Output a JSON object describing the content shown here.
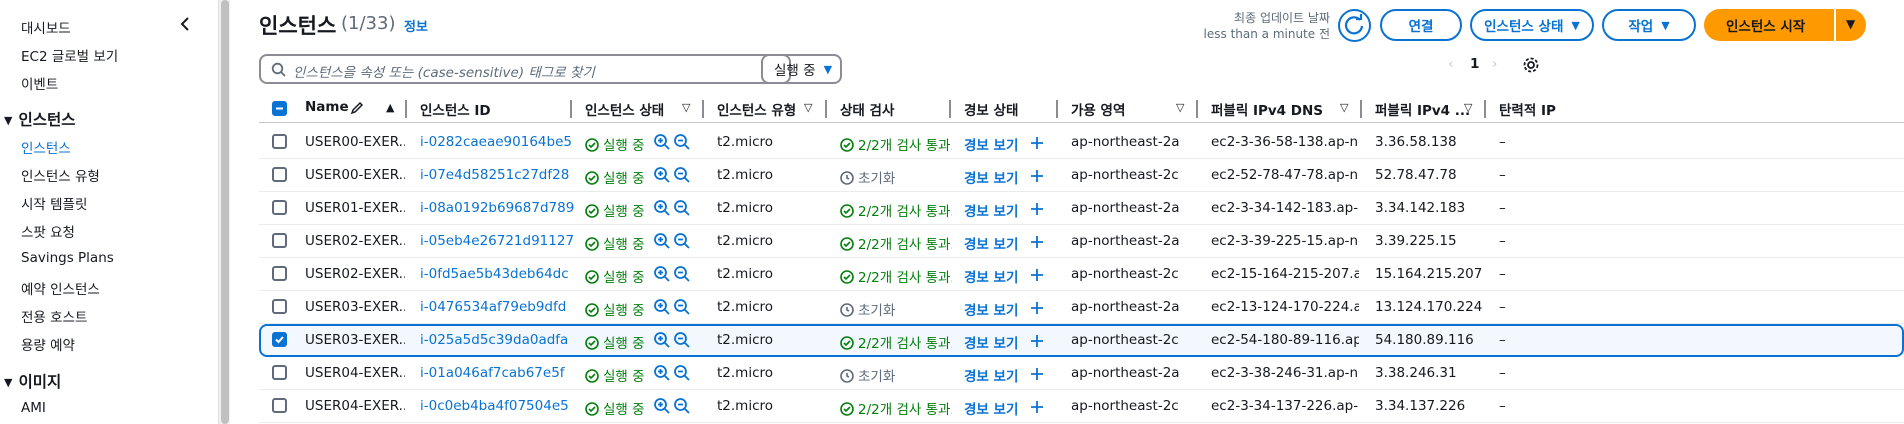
{
  "sidebar": {
    "top_items": [
      "대시보드",
      "EC2 글로벌 보기",
      "이벤트"
    ],
    "sections": [
      {
        "title": "인스턴스",
        "items": [
          "인스턴스",
          "인스턴스 유형",
          "시작 템플릿",
          "스팟 요청",
          "Savings Plans",
          "예약 인스턴스",
          "전용 호스트",
          "용량 예약"
        ]
      },
      {
        "title": "이미지",
        "items": [
          "AMI"
        ]
      }
    ]
  },
  "header": {
    "title": "인스턴스",
    "count": "(1/33)",
    "info": "정보",
    "last_update_label": "최종 업데이트 날짜",
    "last_update_value": "less than a minute 전",
    "connect": "연결",
    "instance_state": "인스턴스 상태",
    "actions": "작업",
    "launch": "인스턴스 시작"
  },
  "search": {
    "placeholder": "인스턴스을 속성 또는 (case-sensitive) 태그로 찾기"
  },
  "state_filter": "실행 중",
  "pager": {
    "page": "1"
  },
  "columns": [
    "Name",
    "인스턴스 ID",
    "인스턴스 상태",
    "인스턴스 유형",
    "상태 검사",
    "경보 상태",
    "가용 영역",
    "퍼블릭 IPv4 DNS",
    "퍼블릭 IPv4 ...",
    "탄력적 IP"
  ],
  "rows": [
    {
      "name": "USER00-EXER...",
      "id": "i-0282caeae90164be5",
      "state": "실행 중",
      "type": "t2.micro",
      "check": "2/2개 검사 통과...",
      "check_ok": true,
      "alarm": "경보 보기",
      "az": "ap-northeast-2a",
      "dns": "ec2-3-36-58-138.ap-no...",
      "ip": "3.36.58.138",
      "eip": "–",
      "checked": false
    },
    {
      "name": "USER00-EXER...",
      "id": "i-07e4d58251c27df28",
      "state": "실행 중",
      "type": "t2.micro",
      "check": "초기화",
      "check_ok": false,
      "alarm": "경보 보기",
      "az": "ap-northeast-2c",
      "dns": "ec2-52-78-47-78.ap-no...",
      "ip": "52.78.47.78",
      "eip": "–",
      "checked": false
    },
    {
      "name": "USER01-EXER...",
      "id": "i-08a0192b69687d789",
      "state": "실행 중",
      "type": "t2.micro",
      "check": "2/2개 검사 통과...",
      "check_ok": true,
      "alarm": "경보 보기",
      "az": "ap-northeast-2a",
      "dns": "ec2-3-34-142-183.ap-n...",
      "ip": "3.34.142.183",
      "eip": "–",
      "checked": false
    },
    {
      "name": "USER02-EXER...",
      "id": "i-05eb4e26721d91127",
      "state": "실행 중",
      "type": "t2.micro",
      "check": "2/2개 검사 통과...",
      "check_ok": true,
      "alarm": "경보 보기",
      "az": "ap-northeast-2a",
      "dns": "ec2-3-39-225-15.ap-no...",
      "ip": "3.39.225.15",
      "eip": "–",
      "checked": false
    },
    {
      "name": "USER02-EXER...",
      "id": "i-0fd5ae5b43deb64dc",
      "state": "실행 중",
      "type": "t2.micro",
      "check": "2/2개 검사 통과...",
      "check_ok": true,
      "alarm": "경보 보기",
      "az": "ap-northeast-2c",
      "dns": "ec2-15-164-215-207.ap...",
      "ip": "15.164.215.207",
      "eip": "–",
      "checked": false
    },
    {
      "name": "USER03-EXER...",
      "id": "i-0476534af79eb9dfd",
      "state": "실행 중",
      "type": "t2.micro",
      "check": "초기화",
      "check_ok": false,
      "alarm": "경보 보기",
      "az": "ap-northeast-2a",
      "dns": "ec2-13-124-170-224.ap...",
      "ip": "13.124.170.224",
      "eip": "–",
      "checked": false
    },
    {
      "name": "USER03-EXER...",
      "id": "i-025a5d5c39da0adfa",
      "state": "실행 중",
      "type": "t2.micro",
      "check": "2/2개 검사 통과...",
      "check_ok": true,
      "alarm": "경보 보기",
      "az": "ap-northeast-2c",
      "dns": "ec2-54-180-89-116.ap-...",
      "ip": "54.180.89.116",
      "eip": "–",
      "checked": true
    },
    {
      "name": "USER04-EXER...",
      "id": "i-01a046af7cab67e5f",
      "state": "실행 중",
      "type": "t2.micro",
      "check": "초기화",
      "check_ok": false,
      "alarm": "경보 보기",
      "az": "ap-northeast-2a",
      "dns": "ec2-3-38-246-31.ap-no...",
      "ip": "3.38.246.31",
      "eip": "–",
      "checked": false
    },
    {
      "name": "USER04-EXER...",
      "id": "i-0c0eb4ba4f07504e5",
      "state": "실행 중",
      "type": "t2.micro",
      "check": "2/2개 검사 통과...",
      "check_ok": true,
      "alarm": "경보 보기",
      "az": "ap-northeast-2c",
      "dns": "ec2-3-34-137-226.ap-n...",
      "ip": "3.34.137.226",
      "eip": "–",
      "checked": false
    }
  ]
}
